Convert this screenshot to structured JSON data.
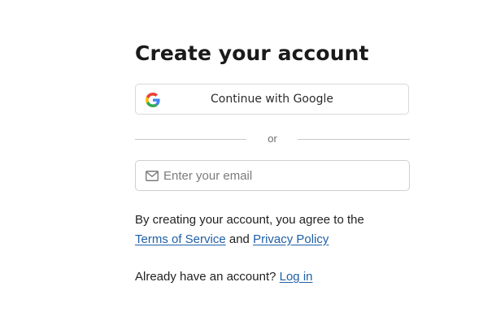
{
  "heading": "Create your account",
  "google": {
    "label": "Continue with Google",
    "icon": "google-g-icon"
  },
  "divider": "or",
  "email": {
    "placeholder": "Enter your email",
    "value": "",
    "icon": "mail-icon"
  },
  "terms": {
    "prefix": "By creating your account, you agree to the",
    "tos_link": "Terms of Service",
    "and": "and",
    "privacy_link": "Privacy Policy"
  },
  "login": {
    "prompt": "Already have an account?",
    "link": "Log in"
  },
  "colors": {
    "link": "#1f5fa6",
    "border": "#d9d9d9",
    "google_blue": "#4285F4",
    "google_red": "#EA4335",
    "google_yellow": "#FBBC05",
    "google_green": "#34A853"
  }
}
